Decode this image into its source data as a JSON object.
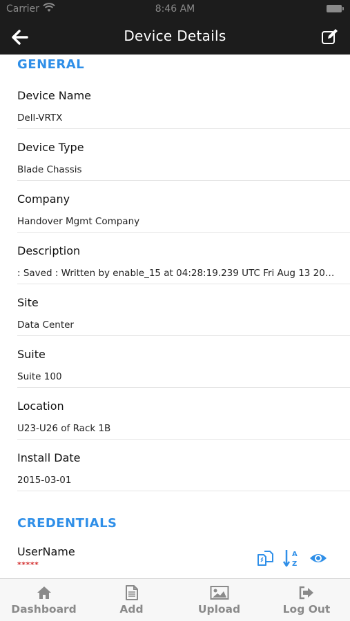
{
  "status_bar": {
    "carrier": "Carrier",
    "time": "8:46 AM"
  },
  "nav": {
    "title": "Device Details",
    "back_icon": "arrow-left-icon",
    "edit_icon": "edit-icon"
  },
  "general": {
    "header": "GENERAL",
    "fields": [
      {
        "label": "Device Name",
        "value": "Dell-VRTX"
      },
      {
        "label": "Device Type",
        "value": "Blade Chassis"
      },
      {
        "label": "Company",
        "value": "Handover Mgmt Company"
      },
      {
        "label": "Description",
        "value": ": Saved : Written by enable_15 at 04:28:19.239 UTC Fri Aug 13 200…"
      },
      {
        "label": "Site",
        "value": "Data Center"
      },
      {
        "label": "Suite",
        "value": "Suite 100"
      },
      {
        "label": "Location",
        "value": "U23-U26 of Rack 1B"
      },
      {
        "label": "Install Date",
        "value": "2015-03-01"
      }
    ]
  },
  "credentials": {
    "header": "CREDENTIALS",
    "username_label": "UserName",
    "username_masked": "*****",
    "icons": [
      "copy-icon",
      "sort-alpha-icon",
      "eye-icon"
    ]
  },
  "tabs": [
    {
      "label": "Dashboard",
      "icon": "home-icon"
    },
    {
      "label": "Add",
      "icon": "document-icon"
    },
    {
      "label": "Upload",
      "icon": "image-icon"
    },
    {
      "label": "Log Out",
      "icon": "logout-icon"
    }
  ],
  "colors": {
    "accent": "#2f8fe8",
    "nav_bg": "#1c1c1c",
    "masked_red": "#d32f2f",
    "tab_gray": "#8a8a8a"
  }
}
